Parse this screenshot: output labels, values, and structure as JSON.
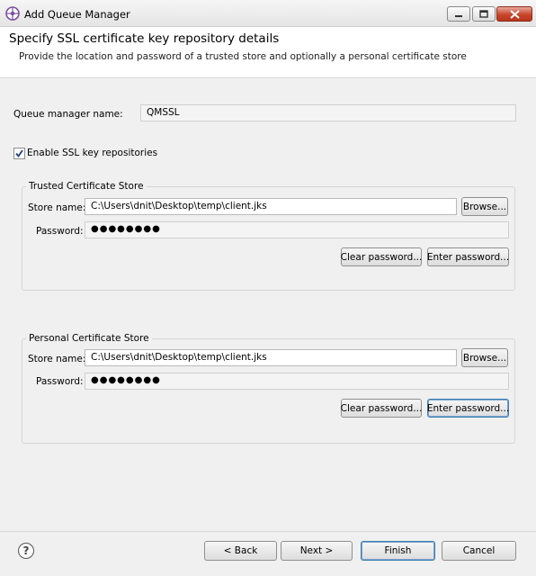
{
  "window": {
    "title": "Add Queue Manager",
    "icon": "queue-manager-app-icon",
    "controls": [
      "minimize",
      "maximize",
      "close"
    ]
  },
  "header": {
    "title": "Specify SSL certificate key repository details",
    "subtitle": "Provide the location and password of a trusted store and optionally a personal certificate store"
  },
  "queue_manager": {
    "label": "Queue manager name:",
    "value": "QMSSL"
  },
  "enable_ssl": {
    "label": "Enable SSL key repositories",
    "checked": true
  },
  "trusted_store": {
    "legend": "Trusted Certificate Store",
    "store_label": "Store name:",
    "store_value": "C:\\Users\\dnit\\Desktop\\temp\\client.jks",
    "browse_label": "Browse...",
    "password_label": "Password:",
    "password_value": "●●●●●●●●",
    "clear_label": "Clear password...",
    "enter_label": "Enter password..."
  },
  "personal_store": {
    "legend": "Personal Certificate Store",
    "store_label": "Store name:",
    "store_value": "C:\\Users\\dnit\\Desktop\\temp\\client.jks",
    "browse_label": "Browse...",
    "password_label": "Password:",
    "password_value": "●●●●●●●●",
    "clear_label": "Clear password...",
    "enter_label": "Enter password..."
  },
  "footer": {
    "help_glyph": "?",
    "back_label": "< Back",
    "next_label": "Next >",
    "finish_label": "Finish",
    "cancel_label": "Cancel"
  },
  "colors": {
    "accent": "#7b4fa0",
    "close_button": "#c8462b"
  }
}
